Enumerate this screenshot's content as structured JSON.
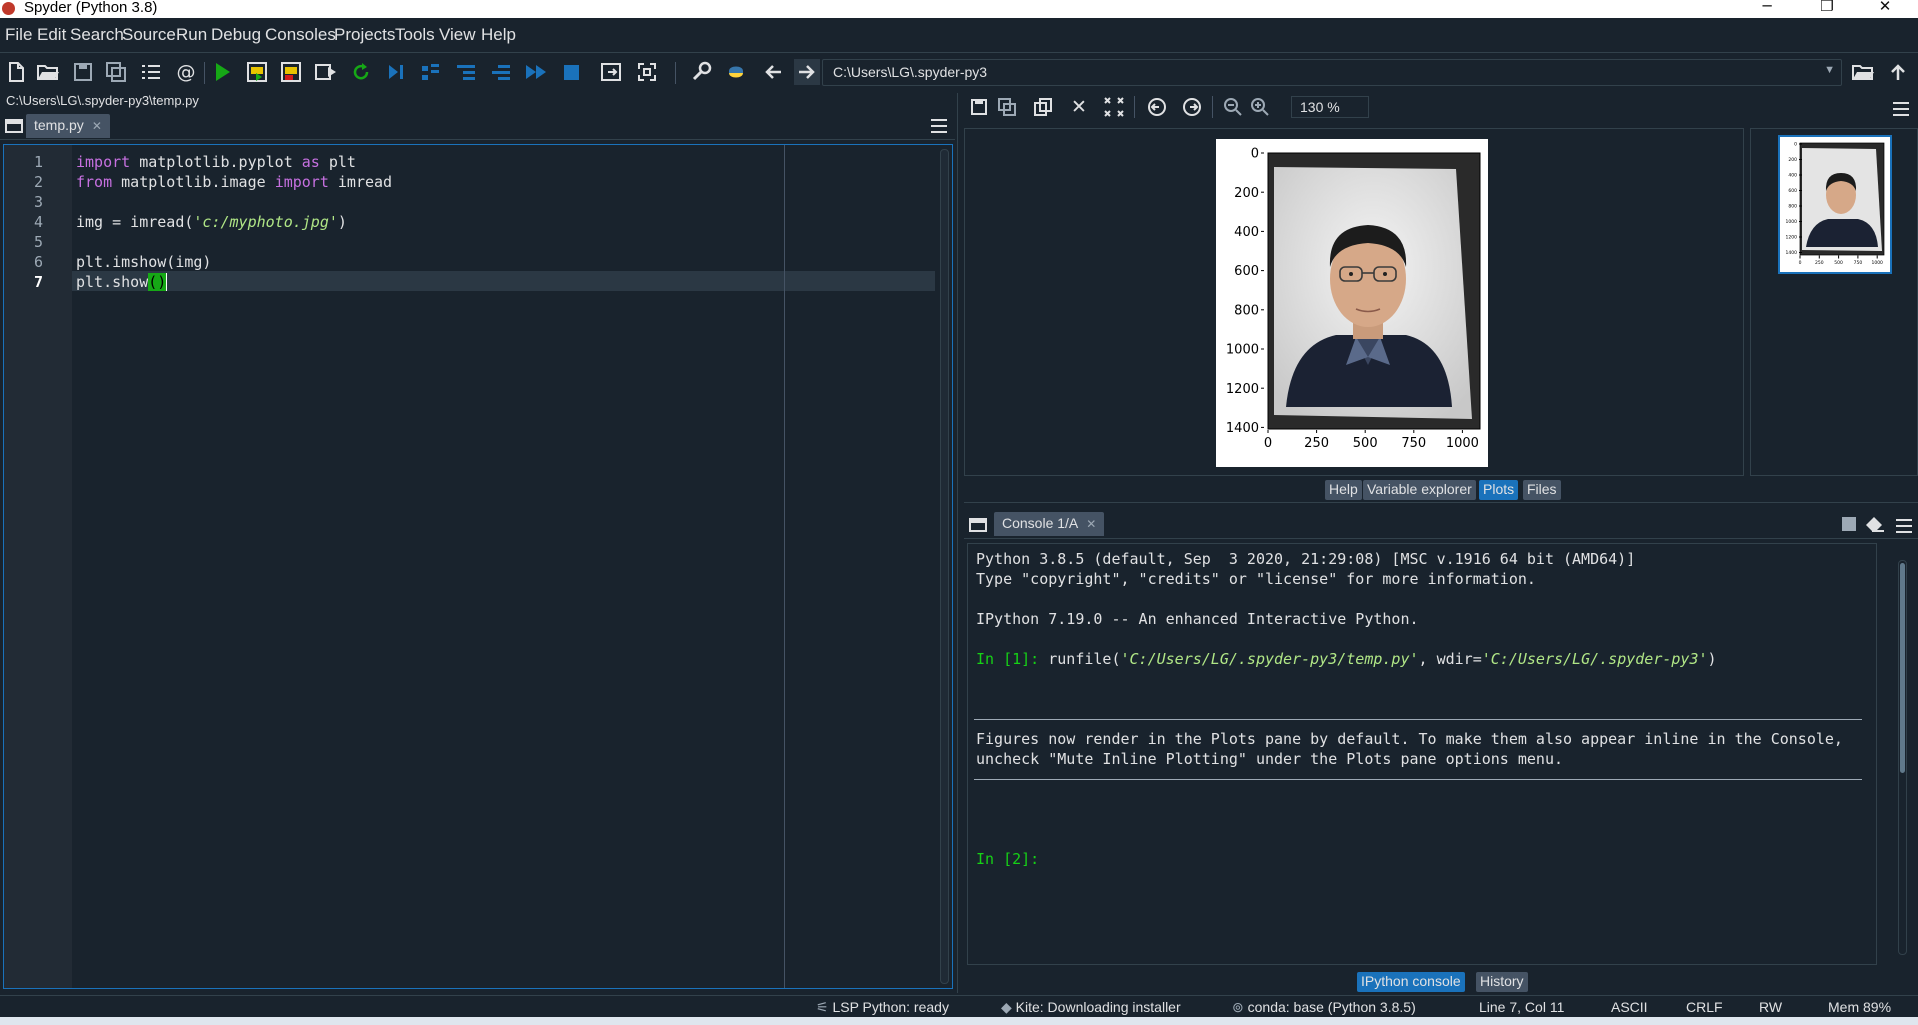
{
  "window": {
    "title": "Spyder (Python 3.8)",
    "minimize": "─",
    "maximize": "❐",
    "close": "✕"
  },
  "menu": [
    "File",
    "Edit",
    "Search",
    "Source",
    "Run",
    "Debug",
    "Consoles",
    "Projects",
    "Tools",
    "View",
    "Help"
  ],
  "toolbar": {
    "working_directory": "C:\\Users\\LG\\.spyder-py3"
  },
  "editor": {
    "file_path": "C:\\Users\\LG\\.spyder-py3\\temp.py",
    "tab_label": "temp.py",
    "current_line": 7,
    "lines": [
      {
        "n": "1"
      },
      {
        "n": "2"
      },
      {
        "n": "3"
      },
      {
        "n": "4"
      },
      {
        "n": "5"
      },
      {
        "n": "6"
      },
      {
        "n": "7"
      }
    ],
    "code": {
      "l1_kw1": "import",
      "l1_mid": " matplotlib.pyplot ",
      "l1_kw2": "as",
      "l1_end": " plt",
      "l2_kw1": "from",
      "l2_mid": " matplotlib.image ",
      "l2_kw2": "import",
      "l2_end": " imread",
      "l4_start": "img = imread(",
      "l4_str": "'c:/myphoto.jpg'",
      "l4_end": ")",
      "l6": "plt.imshow(img)",
      "l7_start": "plt.show",
      "l7_paren": "()"
    }
  },
  "plots": {
    "zoom": "130 %",
    "y_ticks": [
      "0",
      "200",
      "400",
      "600",
      "800",
      "1000",
      "1200",
      "1400"
    ],
    "x_ticks": [
      "0",
      "250",
      "500",
      "750",
      "1000"
    ],
    "thumb_y_ticks": [
      "0",
      "200",
      "400",
      "600",
      "800",
      "1000",
      "1200",
      "1400"
    ],
    "thumb_x_ticks": [
      "0",
      "250",
      "500",
      "750",
      "1000"
    ],
    "tabs": [
      "Help",
      "Variable explorer",
      "Plots",
      "Files"
    ],
    "active_tab": "Plots"
  },
  "console": {
    "tab_label": "Console 1/A",
    "line1": "Python 3.8.5 (default, Sep  3 2020, 21:29:08) [MSC v.1916 64 bit (AMD64)]",
    "line2": "Type \"copyright\", \"credits\" or \"license\" for more information.",
    "line3": "IPython 7.19.0 -- An enhanced Interactive Python.",
    "prompt1": "In [1]:",
    "run_cmd_start": " runfile(",
    "run_cmd_str1": "'C:/Users/LG/.spyder-py3/temp.py'",
    "run_cmd_mid": ", wdir=",
    "run_cmd_str2": "'C:/Users/LG/.spyder-py3'",
    "run_cmd_end": ")",
    "notice1": "Figures now render in the Plots pane by default. To make them also appear inline in the Console,",
    "notice2": "uncheck \"Mute Inline Plotting\" under the Plots pane options menu.",
    "prompt2": "In [2]:",
    "bottom_tabs": [
      "IPython console",
      "History"
    ],
    "active_bottom_tab": "IPython console"
  },
  "status": {
    "lsp": "LSP Python: ready",
    "kite": "Kite: Downloading installer",
    "conda": "conda: base (Python 3.8.5)",
    "position": "Line 7, Col 11",
    "encoding": "ASCII",
    "eol": "CRLF",
    "permissions": "RW",
    "memory": "Mem 89%"
  },
  "colors": {
    "background": "#19232d",
    "accent": "#1a72bb",
    "keyword": "#c670e0",
    "string": "#b0e686",
    "prompt": "#16d216"
  }
}
